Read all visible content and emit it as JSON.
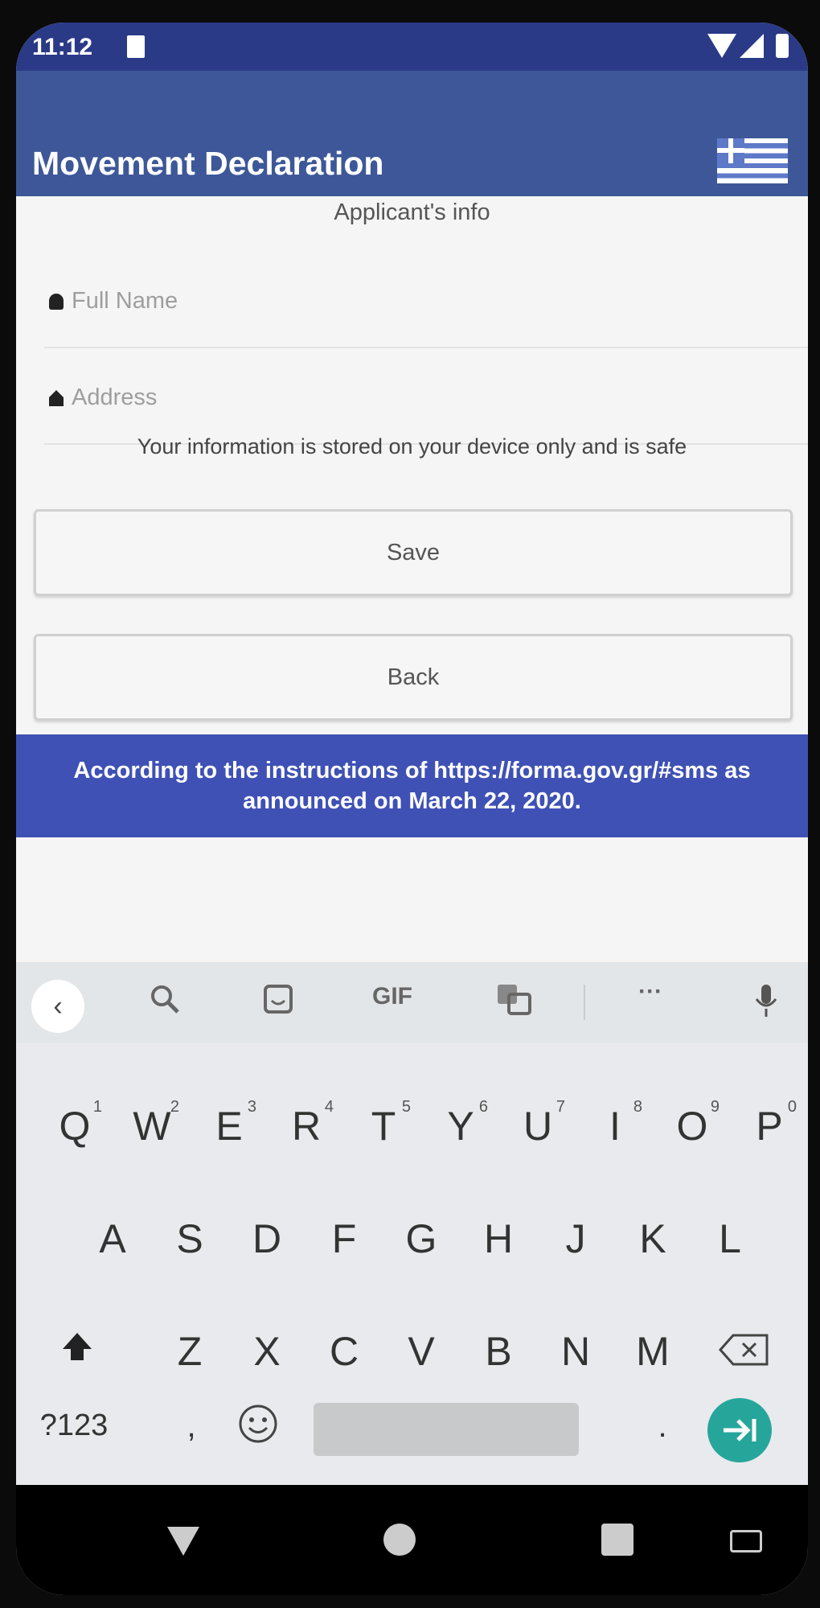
{
  "status_bar": {
    "time": "11:12"
  },
  "app_bar": {
    "title": "Movement Declaration"
  },
  "form": {
    "section_title": "Applicant's info",
    "full_name_placeholder": "Full Name",
    "address_placeholder": "Address",
    "note": "Your information is stored on your device only and is safe",
    "save_label": "Save",
    "back_label": "Back"
  },
  "banner": {
    "text": "According to the instructions of https://forma.gov.gr/#sms as announced on March 22, 2020."
  },
  "keyboard": {
    "toolbar": {
      "gif_label": "GIF",
      "more_label": "···"
    },
    "row1": [
      {
        "k": "Q",
        "n": "1"
      },
      {
        "k": "W",
        "n": "2"
      },
      {
        "k": "E",
        "n": "3"
      },
      {
        "k": "R",
        "n": "4"
      },
      {
        "k": "T",
        "n": "5"
      },
      {
        "k": "Y",
        "n": "6"
      },
      {
        "k": "U",
        "n": "7"
      },
      {
        "k": "I",
        "n": "8"
      },
      {
        "k": "O",
        "n": "9"
      },
      {
        "k": "P",
        "n": "0"
      }
    ],
    "row2": [
      "A",
      "S",
      "D",
      "F",
      "G",
      "H",
      "J",
      "K",
      "L"
    ],
    "row3": [
      "Z",
      "X",
      "C",
      "V",
      "B",
      "N",
      "M"
    ],
    "symbols_label": "?123",
    "comma_label": ",",
    "period_label": "."
  },
  "colors": {
    "status_bar": "#2b3a86",
    "app_bar": "#3d5798",
    "banner": "#3f51b5",
    "enter_key": "#26a69a"
  }
}
